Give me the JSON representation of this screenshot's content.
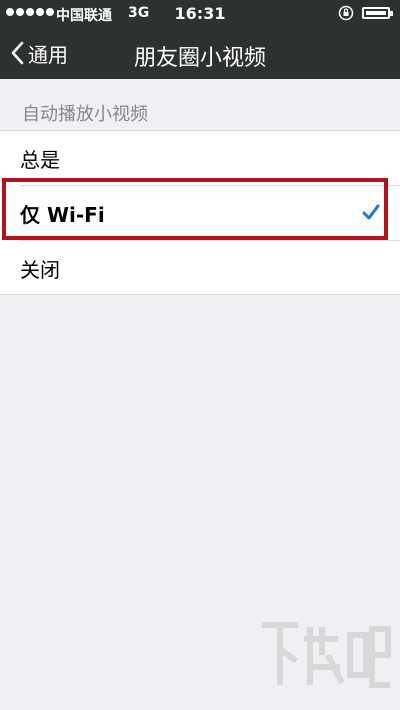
{
  "status_bar": {
    "carrier": "中国联通",
    "network": "3G",
    "time": "16:31",
    "icons": [
      "signal-dots",
      "orientation-lock-icon",
      "battery-icon"
    ]
  },
  "nav": {
    "back_label": "通用",
    "title": "朋友圈小视频"
  },
  "section": {
    "header": "自动播放小视频",
    "options": [
      {
        "label": "总是",
        "selected": false
      },
      {
        "label": "仅 Wi-Fi",
        "selected": true
      },
      {
        "label": "关闭",
        "selected": false
      }
    ]
  },
  "colors": {
    "bar_background": "#2e3132",
    "page_background": "#efeff4",
    "checkmark": "#1a7bd6",
    "highlight_box": "#b3121c"
  }
}
